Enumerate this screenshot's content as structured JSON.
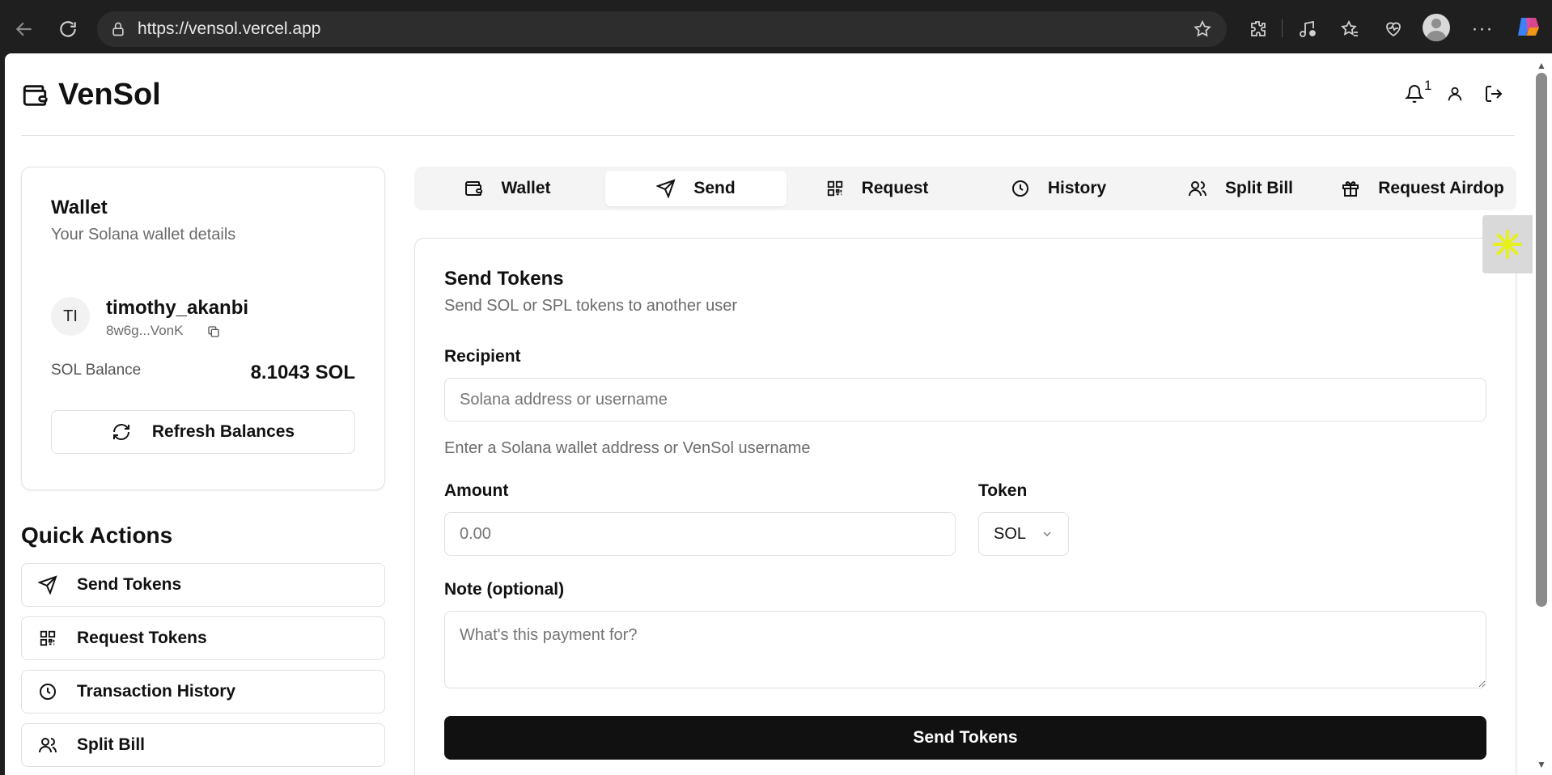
{
  "browser": {
    "url": "https://vensol.vercel.app",
    "icons": [
      "back-icon",
      "reload-icon",
      "lock-icon",
      "star-icon",
      "extensions-icon",
      "media-icon",
      "favorites-icon",
      "health-icon",
      "profile-icon",
      "more-icon",
      "copilot-icon"
    ]
  },
  "header": {
    "brand": "VenSol",
    "notification_count": "1"
  },
  "wallet": {
    "title": "Wallet",
    "subtitle": "Your Solana wallet details",
    "avatar_initials": "TI",
    "username": "timothy_akanbi",
    "address_short": "8w6g...VonK",
    "balance_label": "SOL Balance",
    "balance_value": "8.1043 SOL",
    "refresh_label": "Refresh Balances"
  },
  "quick_actions": {
    "title": "Quick Actions",
    "items": [
      {
        "label": "Send Tokens",
        "icon": "send-icon"
      },
      {
        "label": "Request Tokens",
        "icon": "qr-icon"
      },
      {
        "label": "Transaction History",
        "icon": "clock-icon"
      },
      {
        "label": "Split Bill",
        "icon": "users-icon"
      }
    ]
  },
  "tabs": [
    {
      "label": "Wallet",
      "icon": "wallet-icon",
      "active": false
    },
    {
      "label": "Send",
      "icon": "send-icon",
      "active": true
    },
    {
      "label": "Request",
      "icon": "qr-icon",
      "active": false
    },
    {
      "label": "History",
      "icon": "clock-icon",
      "active": false
    },
    {
      "label": "Split Bill",
      "icon": "users-icon",
      "active": false
    },
    {
      "label": "Request Airdop",
      "icon": "gift-icon",
      "active": false
    }
  ],
  "send_form": {
    "title": "Send Tokens",
    "subtitle": "Send SOL or SPL tokens to another user",
    "recipient_label": "Recipient",
    "recipient_placeholder": "Solana address or username",
    "recipient_hint": "Enter a Solana wallet address or VenSol username",
    "amount_label": "Amount",
    "amount_placeholder": "0.00",
    "token_label": "Token",
    "token_value": "SOL",
    "note_label": "Note (optional)",
    "note_placeholder": "What's this payment for?",
    "submit_label": "Send Tokens"
  },
  "colors": {
    "primary_button": "#111111",
    "tab_bar_bg": "#f4f4f5",
    "side_widget_accent": "#e6f01e"
  }
}
